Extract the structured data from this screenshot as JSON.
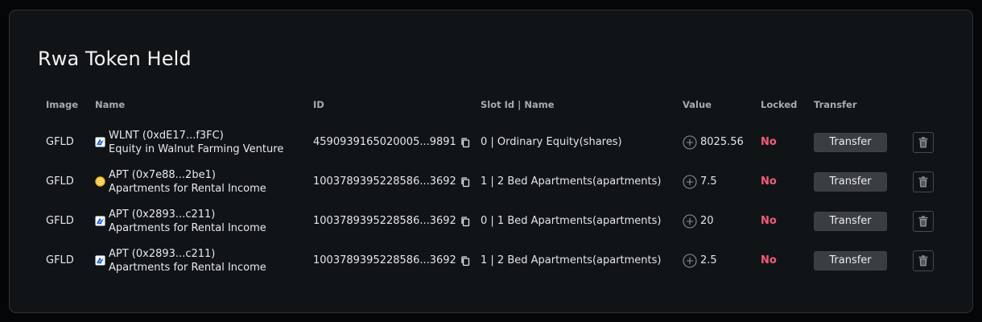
{
  "panel": {
    "title": "Rwa Token Held"
  },
  "table": {
    "headers": {
      "image": "Image",
      "name": "Name",
      "id": "ID",
      "slot": "Slot Id | Name",
      "value": "Value",
      "locked": "Locked",
      "transfer": "Transfer"
    },
    "rows": [
      {
        "image": "GFLD",
        "name_line1": "WLNT (0xdE17...f3FC)",
        "name_line2": "Equity in Walnut Farming Venture",
        "chain_icon": "chain-logo-icon",
        "id": "4590939165020005...9891",
        "slot": "0 | Ordinary Equity(shares)",
        "value": "8025.56",
        "locked": "No",
        "transfer_label": "Transfer"
      },
      {
        "image": "GFLD",
        "name_line1": "APT (0x7e88...2be1)",
        "name_line2": "Apartments for Rental Income",
        "chain_icon": "coin-logo-icon",
        "id": "1003789395228586...3692",
        "slot": "1 | 2 Bed Apartments(apartments)",
        "value": "7.5",
        "locked": "No",
        "transfer_label": "Transfer"
      },
      {
        "image": "GFLD",
        "name_line1": "APT (0x2893...c211)",
        "name_line2": "Apartments for Rental Income",
        "chain_icon": "chain-logo-icon",
        "id": "1003789395228586...3692",
        "slot": "0 | 1 Bed Apartments(apartments)",
        "value": "20",
        "locked": "No",
        "transfer_label": "Transfer"
      },
      {
        "image": "GFLD",
        "name_line1": "APT (0x2893...c211)",
        "name_line2": "Apartments for Rental Income",
        "chain_icon": "chain-logo-icon",
        "id": "1003789395228586...3692",
        "slot": "1 | 2 Bed Apartments(apartments)",
        "value": "2.5",
        "locked": "No",
        "transfer_label": "Transfer"
      }
    ]
  },
  "colors": {
    "background": "#050608",
    "panel": "#111417",
    "locked_no": "#f25c7a",
    "button": "#3a3d42",
    "coin_icon": "#f2b81c",
    "chain_icon": "#2d7fe0"
  }
}
